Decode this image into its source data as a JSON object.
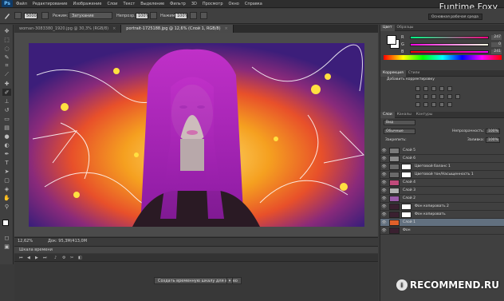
{
  "app": {
    "logo": "Ps"
  },
  "menu": [
    "Файл",
    "Редактирование",
    "Изображение",
    "Слои",
    "Текст",
    "Выделение",
    "Фильтр",
    "3D",
    "Просмотр",
    "Окно",
    "Справка"
  ],
  "options": {
    "size": "5000",
    "mode_label": "Режим:",
    "mode_value": "Затухание",
    "opacity_label": "Непрозр.:",
    "opacity_value": "100%",
    "flow_label": "Нажим:",
    "flow_value": "100%"
  },
  "watermark": {
    "top": "Funtime Foxy",
    "bottom": "RECOMMEND.RU"
  },
  "workspace": "Основная рабочая среда",
  "tabs": [
    {
      "label": "woman-3083380_1920.jpg @ 30,3% (RGB/8)",
      "active": false
    },
    {
      "label": "portrait-1725188.jpg @ 12,6% (Слой 1, RGB/8)",
      "active": true
    }
  ],
  "status": {
    "zoom": "12,62%",
    "doc": "Док: 95,3M/413,0M"
  },
  "timeline": {
    "title": "Шкала времени",
    "button": "Создать временную шкалу для видео"
  },
  "panels": {
    "color_tabs": [
      "Цвет",
      "Образцы"
    ],
    "channels": [
      {
        "label": "R",
        "value": "247",
        "gradient": "#00ff85,#ff0085"
      },
      {
        "label": "G",
        "value": "0",
        "gradient": "#f700e3,#f7ffe3"
      },
      {
        "label": "B",
        "value": "241",
        "gradient": "#f70000,#f700ff"
      }
    ],
    "adjust_tabs": [
      "Коррекция",
      "Стили"
    ],
    "adjust_title": "Добавить корректировку",
    "layers_tabs": [
      "Слои",
      "Каналы",
      "Контуры"
    ],
    "kind": "Вид",
    "blend": "Обычные",
    "opacity_label": "Непрозрачность:",
    "opacity_value": "100%",
    "lock_label": "Закрепить:",
    "fill_label": "Заливка:",
    "fill_value": "100%",
    "layers": [
      {
        "name": "Слой 5",
        "thumb": "#7a7a7a",
        "mask": false,
        "selected": false
      },
      {
        "name": "Слой 6",
        "thumb": "#8a8a8a",
        "mask": false,
        "selected": false
      },
      {
        "name": "Цветовой баланс 1",
        "thumb": "#6a6a6a",
        "mask": true,
        "selected": false
      },
      {
        "name": "Цветовой тон/Насыщенность 1",
        "thumb": "#6a6a6a",
        "mask": true,
        "selected": false
      },
      {
        "name": "Слой 4",
        "thumb": "#c04a7a",
        "mask": false,
        "selected": false
      },
      {
        "name": "Слой 3",
        "thumb": "#b0b0b0",
        "mask": false,
        "selected": false
      },
      {
        "name": "Слой 2",
        "thumb": "#9a5aa8",
        "mask": false,
        "selected": false
      },
      {
        "name": "Фон копировать 2",
        "thumb": "#3a2030",
        "mask": true,
        "selected": false
      },
      {
        "name": "Фон копировать",
        "thumb": "#3a2030",
        "mask": true,
        "selected": false
      },
      {
        "name": "Слой 1",
        "thumb": "#e0602a",
        "mask": false,
        "selected": true
      },
      {
        "name": "Фон",
        "thumb": "#3a2030",
        "mask": false,
        "selected": false
      }
    ]
  },
  "colors": {
    "accent_hair": "#a020b0",
    "bg_purple": "#3c1e7a",
    "bg_orange": "#f5a020"
  }
}
